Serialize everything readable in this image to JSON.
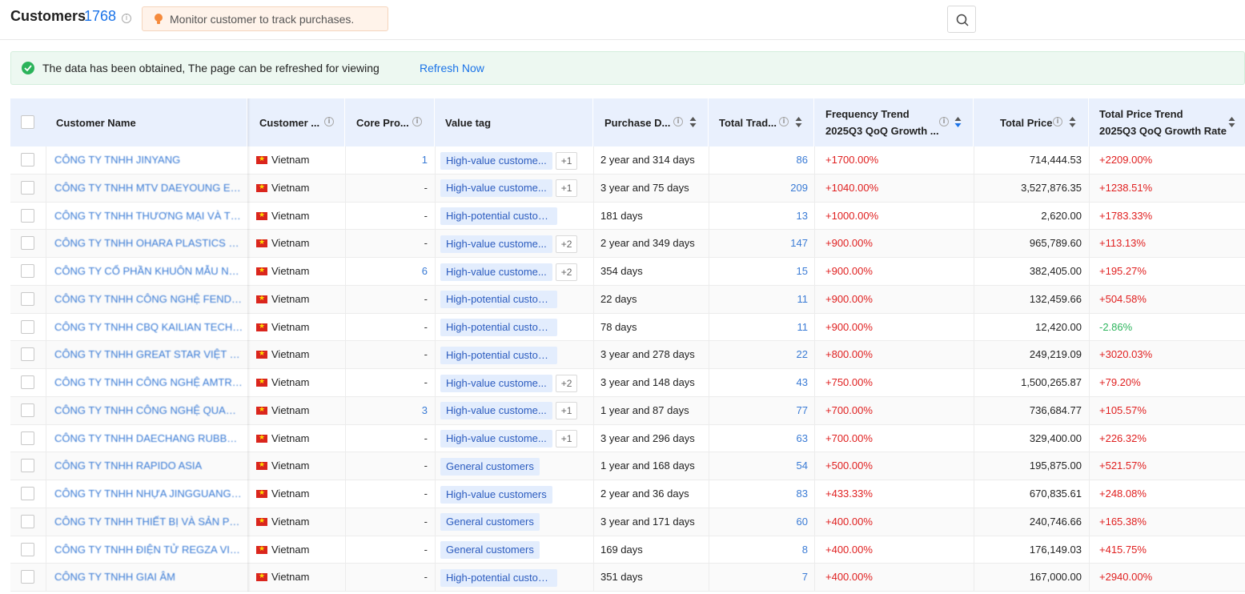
{
  "header": {
    "title": "Customers",
    "count": "1768",
    "tip": "Monitor customer to track purchases."
  },
  "notice": {
    "text": "The data has been obtained, The page can be refreshed for viewing",
    "link": "Refresh Now"
  },
  "columns": {
    "name": "Customer Name",
    "country": "Customer ...",
    "core": "Core Pro...",
    "value_tag": "Value tag",
    "purchase": "Purchase D...",
    "total_trades": "Total Trad...",
    "freq_line1": "Frequency Trend",
    "freq_line2": "2025Q3 QoQ Growth ...",
    "total_price": "Total Price",
    "price_line1": "Total Price Trend",
    "price_line2": "2025Q3 QoQ Growth Rate"
  },
  "colors": {
    "accent": "#1a73e8",
    "positive": "#e02020",
    "negative": "#2db55d",
    "tag_bg": "#e3edfd"
  },
  "rows": [
    {
      "name": "CÔNG TY TNHH JINYANG",
      "country": "Vietnam",
      "core": "1",
      "tag": "High-value custome...",
      "more": "+1",
      "purchase": "2 year and 314 days",
      "trades": "86",
      "freq": "+1700.00%",
      "price": "714,444.53",
      "price_trend": "+2209.00%"
    },
    {
      "name": "CÔNG TY TNHH MTV DAEYOUNG ELE...",
      "country": "Vietnam",
      "core": "-",
      "tag": "High-value custome...",
      "more": "+1",
      "purchase": "3 year and 75 days",
      "trades": "209",
      "freq": "+1040.00%",
      "price": "3,527,876.35",
      "price_trend": "+1238.51%"
    },
    {
      "name": "CÔNG TY TNHH THƯƠNG MẠI VÀ TIẾ...",
      "country": "Vietnam",
      "core": "-",
      "tag": "High-potential customers",
      "more": "",
      "purchase": "181 days",
      "trades": "13",
      "freq": "+1000.00%",
      "price": "2,620.00",
      "price_trend": "+1783.33%"
    },
    {
      "name": "CÔNG TY TNHH OHARA PLASTICS VI...",
      "country": "Vietnam",
      "core": "-",
      "tag": "High-value custome...",
      "more": "+2",
      "purchase": "2 year and 349 days",
      "trades": "147",
      "freq": "+900.00%",
      "price": "965,789.60",
      "price_trend": "+113.13%"
    },
    {
      "name": "CÔNG TY CỔ PHẦN KHUÔN MẪU NH...",
      "country": "Vietnam",
      "core": "6",
      "tag": "High-value custome...",
      "more": "+2",
      "purchase": "354 days",
      "trades": "15",
      "freq": "+900.00%",
      "price": "382,405.00",
      "price_trend": "+195.27%"
    },
    {
      "name": "CÔNG TY TNHH CÔNG NGHỆ FENDA ...",
      "country": "Vietnam",
      "core": "-",
      "tag": "High-potential customers",
      "more": "",
      "purchase": "22 days",
      "trades": "11",
      "freq": "+900.00%",
      "price": "132,459.66",
      "price_trend": "+504.58%"
    },
    {
      "name": "CÔNG TY TNHH CBQ KAILIAN TECHN...",
      "country": "Vietnam",
      "core": "-",
      "tag": "High-potential customers",
      "more": "",
      "purchase": "78 days",
      "trades": "11",
      "freq": "+900.00%",
      "price": "12,420.00",
      "price_trend": "-2.86%"
    },
    {
      "name": "CÔNG TY TNHH GREAT STAR VIỆT N...",
      "country": "Vietnam",
      "core": "-",
      "tag": "High-potential customers",
      "more": "",
      "purchase": "3 year and 278 days",
      "trades": "22",
      "freq": "+800.00%",
      "price": "249,219.09",
      "price_trend": "+3020.03%"
    },
    {
      "name": "CÔNG TY TNHH CÔNG NGHỆ AMTRA...",
      "country": "Vietnam",
      "core": "-",
      "tag": "High-value custome...",
      "more": "+2",
      "purchase": "3 year and 148 days",
      "trades": "43",
      "freq": "+750.00%",
      "price": "1,500,265.87",
      "price_trend": "+79.20%"
    },
    {
      "name": "CÔNG TY TNHH CÔNG NGHỆ QUANG ...",
      "country": "Vietnam",
      "core": "3",
      "tag": "High-value custome...",
      "more": "+1",
      "purchase": "1 year and 87 days",
      "trades": "77",
      "freq": "+700.00%",
      "price": "736,684.77",
      "price_trend": "+105.57%"
    },
    {
      "name": "CÔNG TY TNHH DAECHANG RUBBER ...",
      "country": "Vietnam",
      "core": "-",
      "tag": "High-value custome...",
      "more": "+1",
      "purchase": "3 year and 296 days",
      "trades": "63",
      "freq": "+700.00%",
      "price": "329,400.00",
      "price_trend": "+226.32%"
    },
    {
      "name": "CÔNG TY TNHH RAPIDO ASIA",
      "country": "Vietnam",
      "core": "-",
      "tag": "General customers",
      "more": "",
      "purchase": "1 year and 168 days",
      "trades": "54",
      "freq": "+500.00%",
      "price": "195,875.00",
      "price_trend": "+521.57%"
    },
    {
      "name": "CÔNG TY TNHH NHỰA JINGGUANG Đ...",
      "country": "Vietnam",
      "core": "-",
      "tag": "High-value customers",
      "more": "",
      "purchase": "2 year and 36 days",
      "trades": "83",
      "freq": "+433.33%",
      "price": "670,835.61",
      "price_trend": "+248.08%"
    },
    {
      "name": "CÔNG TY TNHH THIẾT BỊ VÀ SẢN PH...",
      "country": "Vietnam",
      "core": "-",
      "tag": "General customers",
      "more": "",
      "purchase": "3 year and 171 days",
      "trades": "60",
      "freq": "+400.00%",
      "price": "240,746.66",
      "price_trend": "+165.38%"
    },
    {
      "name": "CÔNG TY TNHH ĐIỆN TỬ REGZA VIỆT...",
      "country": "Vietnam",
      "core": "-",
      "tag": "General customers",
      "more": "",
      "purchase": "169 days",
      "trades": "8",
      "freq": "+400.00%",
      "price": "176,149.03",
      "price_trend": "+415.75%"
    },
    {
      "name": "CÔNG TY TNHH GIAI ÂM",
      "country": "Vietnam",
      "core": "-",
      "tag": "High-potential customers",
      "more": "",
      "purchase": "351 days",
      "trades": "7",
      "freq": "+400.00%",
      "price": "167,000.00",
      "price_trend": "+2940.00%"
    }
  ]
}
